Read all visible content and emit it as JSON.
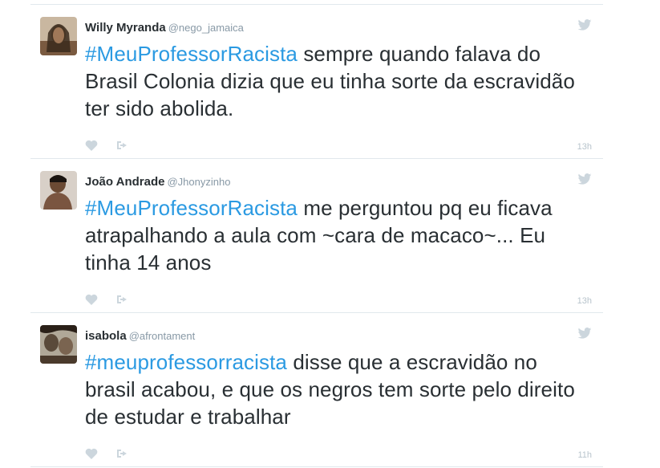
{
  "tweets": [
    {
      "name": "Willy Myranda",
      "handle": "@nego_jamaica",
      "hashtag": "#MeuProfessorRacista",
      "text": " sempre quando falava do Brasil Colonia dizia que eu tinha sorte da escravidão ter sido abolida.",
      "time": "13h",
      "avatar_color": "#8a6a4a"
    },
    {
      "name": "João Andrade",
      "handle": "@Jhonyzinho",
      "hashtag": "#MeuProfessorRacista",
      "text": " me perguntou pq eu ficava atrapalhando a aula com ~cara de macaco~... Eu tinha 14 anos",
      "time": "13h",
      "avatar_color": "#6b4a34"
    },
    {
      "name": "isabola",
      "handle": "@afrontament",
      "hashtag": "#meuprofessorracista",
      "text": " disse que a escravidão no brasil acabou, e que os negros tem sorte pelo direito de estudar e trabalhar",
      "time": "11h",
      "avatar_color": "#5a4a3a"
    }
  ],
  "colors": {
    "hashtag": "#2b9ae2",
    "text": "#292f33",
    "muted": "#8899a6",
    "icon": "#ccd6dd"
  }
}
